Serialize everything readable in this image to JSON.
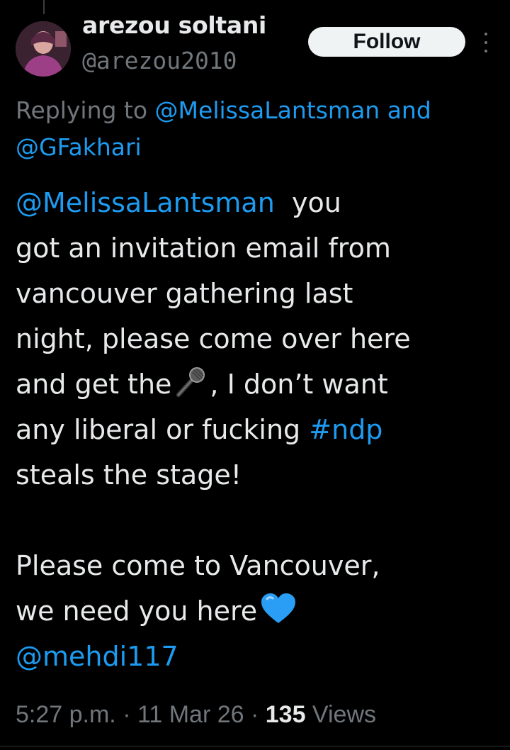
{
  "author": {
    "display_name": "arezou soltani",
    "handle": "@arezou2010"
  },
  "follow_button": {
    "label": "Follow"
  },
  "reply_context": {
    "prefix": "Replying to ",
    "mention_1": "@MelissaLantsman",
    "conjunction": " and",
    "mention_2": "@GFakhari"
  },
  "tweet": {
    "mention_lead": "@MelissaLantsman",
    "lead_text": "  you",
    "line_2": "got an invitation email from",
    "line_3": "vancouver gathering last",
    "line_4": "night, please come over here",
    "line_5_a": "and get the",
    "line_5_emoji": "microphone-emoji",
    "line_5_b": ", I don’t want",
    "line_6_a": "any liberal or fucking ",
    "hashtag": "#ndp",
    "line_7": "steals the stage!",
    "line_8": "Please come to Vancouver,",
    "line_9": "we need you here",
    "line_9_emoji": "blue-heart-emoji",
    "mention_end": "@mehdi117"
  },
  "meta": {
    "time": "5:27 p.m.",
    "sep_1": " · ",
    "date": "11 Mar 26",
    "sep_2": " · ",
    "views_count": "135",
    "views_label": " Views"
  },
  "colors": {
    "background": "#000000",
    "text": "#e7e9ea",
    "secondary": "#71767b",
    "link": "#1d9bf0",
    "button_bg": "#eff3f4"
  }
}
